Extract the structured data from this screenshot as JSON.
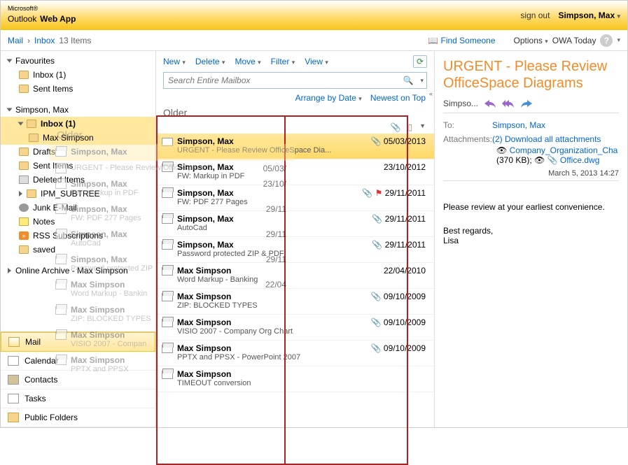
{
  "header": {
    "brand_small": "Microsoft®",
    "brand": "Outlook",
    "brand2": "Web App",
    "signout": "sign out",
    "user": "Simpson, Max"
  },
  "toolbar": {
    "mail": "Mail",
    "inbox": "Inbox",
    "count": "13 Items",
    "find": "Find Someone",
    "options": "Options",
    "owa": "OWA Today"
  },
  "sidebar": {
    "fav": "Favourites",
    "favitems": [
      {
        "label": "Inbox (1)"
      },
      {
        "label": "Sent Items"
      }
    ],
    "user": "Simpson, Max",
    "folders": [
      {
        "label": "Inbox (1)",
        "sel": true,
        "bold": true
      },
      {
        "label": "Max Simpson"
      },
      {
        "label": "Drafts"
      },
      {
        "label": "Sent Items"
      },
      {
        "label": "Deleted Items"
      },
      {
        "label": "IPM_SUBTREE"
      },
      {
        "label": "Junk E-Mail"
      },
      {
        "label": "Notes"
      },
      {
        "label": "RSS Subscriptions"
      },
      {
        "label": "saved"
      }
    ],
    "archive": "Online Archive - Max Simpson",
    "bottom": [
      {
        "label": "Mail",
        "active": true
      },
      {
        "label": "Calendar"
      },
      {
        "label": "Contacts"
      },
      {
        "label": "Tasks"
      },
      {
        "label": "Public Folders"
      }
    ]
  },
  "actions": {
    "new": "New",
    "del": "Delete",
    "move": "Move",
    "filter": "Filter",
    "view": "View"
  },
  "search": {
    "placeholder": "Search Entire Mailbox"
  },
  "arrange": {
    "by": "Arrange by Date",
    "order": "Newest on Top"
  },
  "group": "Older",
  "messages": [
    {
      "from": "Simpson, Max",
      "subj": "URGENT - Please Review OfficeSpace Dia...",
      "date": "05/03/2013",
      "sel": true,
      "clip": true
    },
    {
      "from": "Simpson, Max",
      "subj": "FW: Markup in PDF",
      "date": "23/10/2012"
    },
    {
      "from": "Simpson, Max",
      "subj": "FW: PDF 277 Pages",
      "date": "29/11/2011",
      "clip": true,
      "flag": true
    },
    {
      "from": "Simpson, Max",
      "subj": "AutoCad",
      "date": "29/11/2011",
      "clip": true
    },
    {
      "from": "Simpson, Max",
      "subj": "Password protected ZIP & PDF",
      "date": "29/11/2011",
      "clip": true
    },
    {
      "from": "Max Simpson",
      "subj": "Word Markup - Banking",
      "date": "22/04/2010"
    },
    {
      "from": "Max Simpson",
      "subj": "ZIP: BLOCKED TYPES",
      "date": "09/10/2009",
      "clip": true
    },
    {
      "from": "Max Simpson",
      "subj": "VISIO 2007 - Company Org Chart",
      "date": "09/10/2009",
      "clip": true
    },
    {
      "from": "Max Simpson",
      "subj": "PPTX and PPSX - PowerPoint 2007",
      "date": "09/10/2009",
      "clip": true
    },
    {
      "from": "Max Simpson",
      "subj": "TIMEOUT conversion",
      "date": ""
    }
  ],
  "reading": {
    "subject": "URGENT - Please Review OfficeSpace Diagrams",
    "from": "Simpso...",
    "to_label": "To:",
    "to": "Simpson, Max",
    "att_label": "Attachments:",
    "att_count": "(2)",
    "att_dl": "Download all attachments",
    "att1": "Company_Organization_Cha",
    "att1_size": "(370 KB);",
    "att2": "Office.dwg",
    "timestamp": "March 5, 2013 14:27",
    "body1": "Please review at your earliest convenience.",
    "body2": "Best regards,",
    "body3": "Lisa"
  },
  "ghost": {
    "header": "Older",
    "rows": [
      {
        "from": "Simpson, Max",
        "subj": "",
        "date": "",
        "sel": true
      },
      {
        "from": "",
        "subj": "URGENT - Please Review OfficeSpace D",
        "date": "05/03/"
      },
      {
        "from": "Simpson, Max",
        "subj": "FW: Markup in PDF",
        "date": "23/10/"
      },
      {
        "from": "Simpson, Max",
        "subj": "FW: PDF 277 Pages",
        "date": "29/11"
      },
      {
        "from": "Simpson, Max",
        "subj": "AutoCad",
        "date": "29/11"
      },
      {
        "from": "Simpson, Max",
        "subj": "Password protected ZIP",
        "date": "29/11"
      },
      {
        "from": "Max Simpson",
        "subj": "Word Markup - Bankin",
        "date": "22/04"
      },
      {
        "from": "Max Simpson",
        "subj": "ZIP: BLOCKED TYPES",
        "date": ""
      },
      {
        "from": "Max Simpson",
        "subj": "VISIO 2007 - Compan",
        "date": ""
      },
      {
        "from": "Max Simpson",
        "subj": "PPTX and PPSX",
        "date": ""
      }
    ]
  }
}
